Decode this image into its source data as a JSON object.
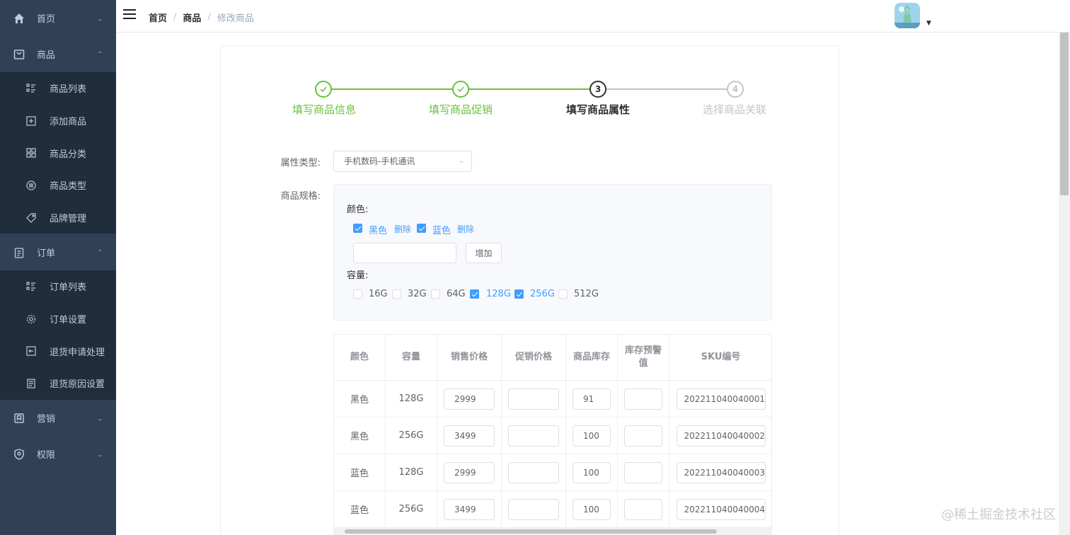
{
  "sidebar": {
    "home": "首页",
    "goods": "商品",
    "goods_items": [
      "商品列表",
      "添加商品",
      "商品分类",
      "商品类型",
      "品牌管理"
    ],
    "order": "订单",
    "order_items": [
      "订单列表",
      "订单设置",
      "退货申请处理",
      "退货原因设置"
    ],
    "marketing": "营销",
    "permission": "权限"
  },
  "breadcrumb": [
    "首页",
    "商品",
    "修改商品"
  ],
  "steps": [
    {
      "title": "填写商品信息",
      "status": "finished"
    },
    {
      "title": "填写商品促销",
      "status": "finished"
    },
    {
      "title": "填写商品属性",
      "status": "process",
      "number": "3"
    },
    {
      "title": "选择商品关联",
      "status": "wait",
      "number": "4"
    }
  ],
  "form": {
    "attr_type_label": "属性类型:",
    "attr_type_value": "手机数码-手机通讯",
    "spec_label": "商品规格:",
    "color_label": "颜色:",
    "colors": [
      {
        "name": "黑色",
        "checked": true
      },
      {
        "name": "蓝色",
        "checked": true
      }
    ],
    "delete_label": "删除",
    "add_button": "增加",
    "add_input_value": "",
    "capacity_label": "容量:",
    "capacities": [
      {
        "name": "16G",
        "checked": false
      },
      {
        "name": "32G",
        "checked": false
      },
      {
        "name": "64G",
        "checked": false
      },
      {
        "name": "128G",
        "checked": true
      },
      {
        "name": "256G",
        "checked": true
      },
      {
        "name": "512G",
        "checked": false
      }
    ]
  },
  "sku_table": {
    "headers": [
      "颜色",
      "容量",
      "销售价格",
      "促销价格",
      "商品库存",
      "库存预警值",
      "SKU编号"
    ],
    "rows": [
      {
        "color": "黑色",
        "capacity": "128G",
        "price": "2999",
        "promo": "",
        "stock": "91",
        "warn": "",
        "sku": "202211040040001"
      },
      {
        "color": "黑色",
        "capacity": "256G",
        "price": "3499",
        "promo": "",
        "stock": "100",
        "warn": "",
        "sku": "202211040040002"
      },
      {
        "color": "蓝色",
        "capacity": "128G",
        "price": "2999",
        "promo": "",
        "stock": "100",
        "warn": "",
        "sku": "202211040040003"
      },
      {
        "color": "蓝色",
        "capacity": "256G",
        "price": "3499",
        "promo": "",
        "stock": "100",
        "warn": "",
        "sku": "202211040040004"
      }
    ]
  },
  "watermark": "@稀土掘金技术社区",
  "colors": {
    "sidebar_bg": "#304156",
    "submenu_bg": "#1f2d3d",
    "success": "#67c23a",
    "primary": "#409eff"
  }
}
